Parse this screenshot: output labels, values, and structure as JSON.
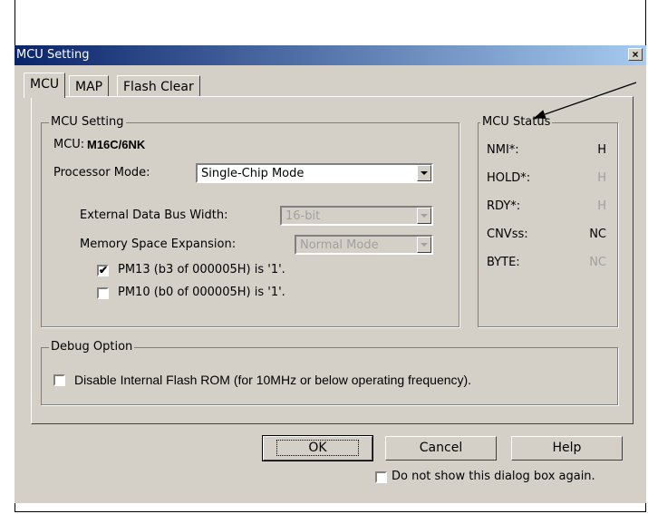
{
  "window": {
    "title": "MCU Setting"
  },
  "tabs": [
    "MCU",
    "MAP",
    "Flash Clear"
  ],
  "mcu_setting": {
    "group_label": "MCU Setting",
    "mcu_label": "MCU:",
    "mcu_value": "M16C/6NK",
    "processor_mode_label": "Processor Mode:",
    "processor_mode_value": "Single-Chip Mode",
    "ext_bus_label": "External Data Bus Width:",
    "ext_bus_value": "16-bit",
    "mem_exp_label": "Memory Space Expansion:",
    "mem_exp_value": "Normal Mode",
    "pm13_label": "PM13 (b3 of 000005H) is '1'.",
    "pm13_checked": true,
    "pm10_label": "PM10 (b0 of 000005H) is '1'.",
    "pm10_checked": false,
    "check_mark": "✔"
  },
  "mcu_status": {
    "group_label": "MCU Status",
    "rows": [
      {
        "name": "NMI*:",
        "value": "H",
        "enabled": true
      },
      {
        "name": "HOLD*:",
        "value": "H",
        "enabled": false
      },
      {
        "name": "RDY*:",
        "value": "H",
        "enabled": false
      },
      {
        "name": "CNVss:",
        "value": "NC",
        "enabled": true
      },
      {
        "name": "BYTE:",
        "value": "NC",
        "enabled": false
      }
    ]
  },
  "debug_option": {
    "group_label": "Debug Option",
    "disable_flash_label": "Disable Internal Flash ROM (for 10MHz or below operating frequency).",
    "disable_flash_checked": false
  },
  "buttons": {
    "ok": "OK",
    "cancel": "Cancel",
    "help": "Help",
    "close": "×"
  },
  "footer": {
    "dont_show_label": "Do not show this dialog box again.",
    "dont_show_checked": false
  }
}
